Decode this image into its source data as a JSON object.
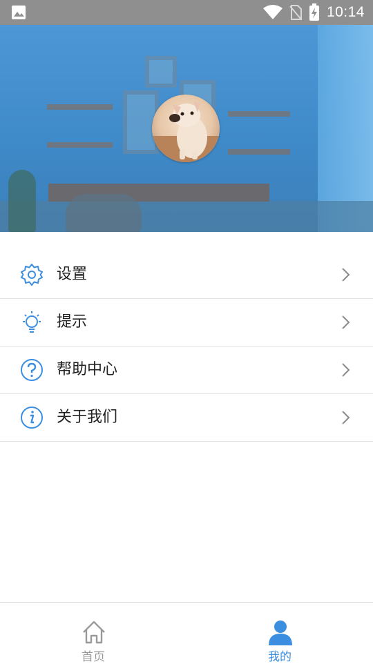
{
  "status_bar": {
    "time": "10:14",
    "icons": [
      "image-icon",
      "wifi-icon",
      "no-sim-icon",
      "battery-charging-icon"
    ]
  },
  "header": {
    "avatar": "avatar-dog-photo"
  },
  "menu": {
    "items": [
      {
        "label": "设置",
        "icon": "gear-icon"
      },
      {
        "label": "提示",
        "icon": "lightbulb-icon"
      },
      {
        "label": "帮助中心",
        "icon": "help-circle-icon"
      },
      {
        "label": "关于我们",
        "icon": "info-circle-icon"
      }
    ]
  },
  "bottom_nav": {
    "tabs": [
      {
        "label": "首页",
        "icon": "home-icon",
        "active": false
      },
      {
        "label": "我的",
        "icon": "person-icon",
        "active": true
      }
    ]
  },
  "colors": {
    "accent": "#3b8ee0",
    "inactive": "#9a9a9a",
    "status_bar": "#8f8f8f"
  }
}
